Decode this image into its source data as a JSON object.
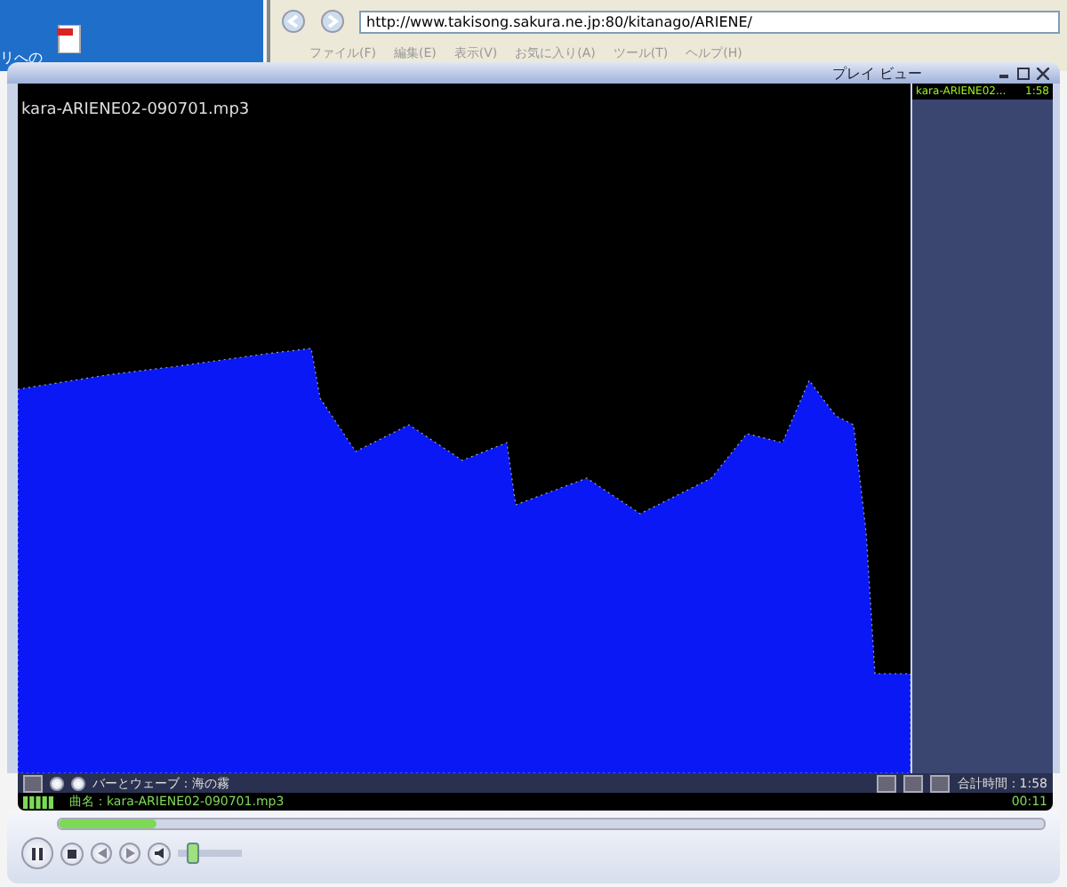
{
  "desktop": {
    "icon_label": "リへの"
  },
  "browser": {
    "address": "http://www.takisong.sakura.ne.jp:80/kitanago/ARIENE/",
    "menu": [
      "ファイル(F)",
      "編集(E)",
      "表示(V)",
      "お気に入り(A)",
      "ツール(T)",
      "ヘルプ(H)"
    ]
  },
  "player": {
    "title": "プレイ ビュー",
    "file_title": "kara-ARIENE02-090701.mp3",
    "playlist": [
      {
        "name": "kara-ARIENE02...",
        "duration": "1:58",
        "selected": true
      }
    ],
    "visualization": "バーとウェーブ：海の霧",
    "total_time": "合計時間：1:58",
    "now_playing": "曲名：kara-ARIENE02-090701.mp3",
    "elapsed": "00:11",
    "seek": {
      "level": 0.1
    },
    "volume": {
      "level": 0.15
    }
  }
}
